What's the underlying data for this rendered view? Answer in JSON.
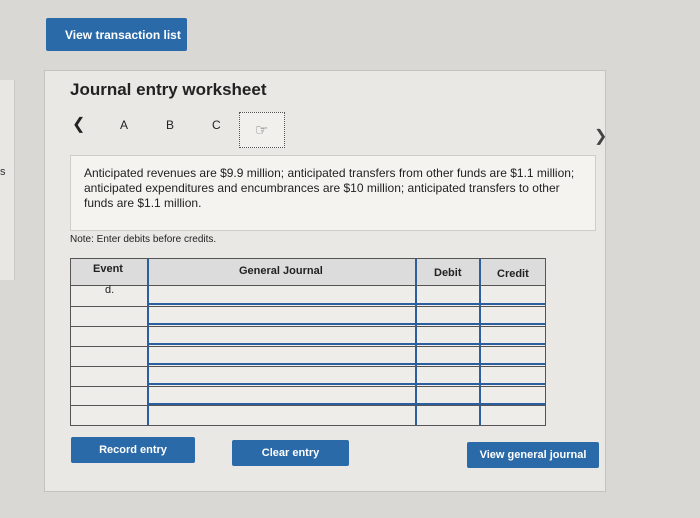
{
  "left_edge": {
    "text": "s"
  },
  "header": {
    "view_transactions_label": "View transaction list"
  },
  "worksheet": {
    "title": "Journal entry worksheet",
    "tabs": [
      "A",
      "B",
      "C"
    ],
    "description": "Anticipated revenues are $9.9 million; anticipated transfers from other funds are $1.1 million; anticipated expenditures and encumbrances are $10 million; anticipated transfers to other funds are $1.1 million.",
    "note": "Note: Enter debits before credits."
  },
  "table": {
    "headers": {
      "event": "Event",
      "general_journal": "General Journal",
      "debit": "Debit",
      "credit": "Credit"
    },
    "rows": [
      {
        "event": "d.",
        "account": "",
        "debit": "",
        "credit": ""
      },
      {
        "event": "",
        "account": "",
        "debit": "",
        "credit": ""
      },
      {
        "event": "",
        "account": "",
        "debit": "",
        "credit": ""
      },
      {
        "event": "",
        "account": "",
        "debit": "",
        "credit": ""
      },
      {
        "event": "",
        "account": "",
        "debit": "",
        "credit": ""
      },
      {
        "event": "",
        "account": "",
        "debit": "",
        "credit": ""
      }
    ]
  },
  "actions": {
    "record_label": "Record entry",
    "clear_label": "Clear entry",
    "view_journal_label": "View general journal"
  }
}
